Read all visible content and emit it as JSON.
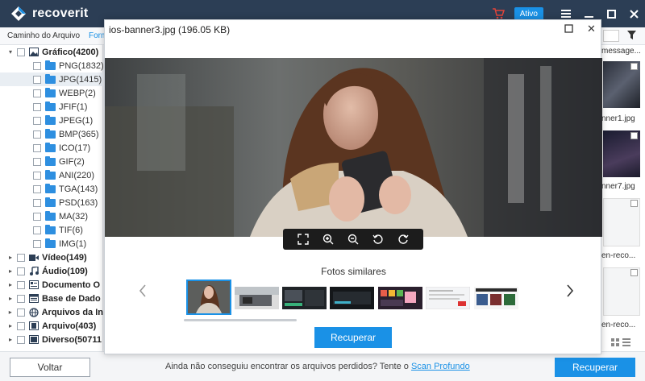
{
  "app": {
    "logo_text": "recoverit",
    "status_badge": "Ativo"
  },
  "tabs": {
    "path": "Caminho do Arquivo",
    "format": "Form"
  },
  "sidebar": {
    "root": {
      "label": "Gráfico(4200)"
    },
    "items": [
      {
        "label": "PNG(1832)"
      },
      {
        "label": "JPG(1415)"
      },
      {
        "label": "WEBP(2)"
      },
      {
        "label": "JFIF(1)"
      },
      {
        "label": "JPEG(1)"
      },
      {
        "label": "BMP(365)"
      },
      {
        "label": "ICO(17)"
      },
      {
        "label": "GIF(2)"
      },
      {
        "label": "ANI(220)"
      },
      {
        "label": "TGA(143)"
      },
      {
        "label": "PSD(163)"
      },
      {
        "label": "MA(32)"
      },
      {
        "label": "TIF(6)"
      },
      {
        "label": "IMG(1)"
      }
    ],
    "categories": [
      {
        "label": "Vídeo(149)",
        "icon": "video-icon"
      },
      {
        "label": "Áudio(109)",
        "icon": "audio-icon"
      },
      {
        "label": "Documento O",
        "icon": "document-icon"
      },
      {
        "label": "Base de Dado",
        "icon": "database-icon"
      },
      {
        "label": "Arquivos da In",
        "icon": "globe-icon"
      },
      {
        "label": "Arquivo(403)",
        "icon": "archive-icon"
      },
      {
        "label": "Diverso(50711",
        "icon": "misc-icon"
      }
    ]
  },
  "rightstrip": {
    "labels": [
      "message...",
      "nner1.jpg",
      "nner7.jpg",
      "en-reco...",
      "en-reco..."
    ]
  },
  "modal": {
    "title": "ios-banner3.jpg (196.05  KB)",
    "similar_title": "Fotos similares",
    "recover_label": "Recuperar"
  },
  "bottom": {
    "back_label": "Voltar",
    "message": "Ainda não conseguiu encontrar os arquivos perdidos? Tente o",
    "link": "Scan Profundo",
    "recover_label": "Recuperar"
  },
  "colors": {
    "titlebar": "#2c3e55",
    "accent": "#1a91e6",
    "folder": "#2e8fe0"
  }
}
